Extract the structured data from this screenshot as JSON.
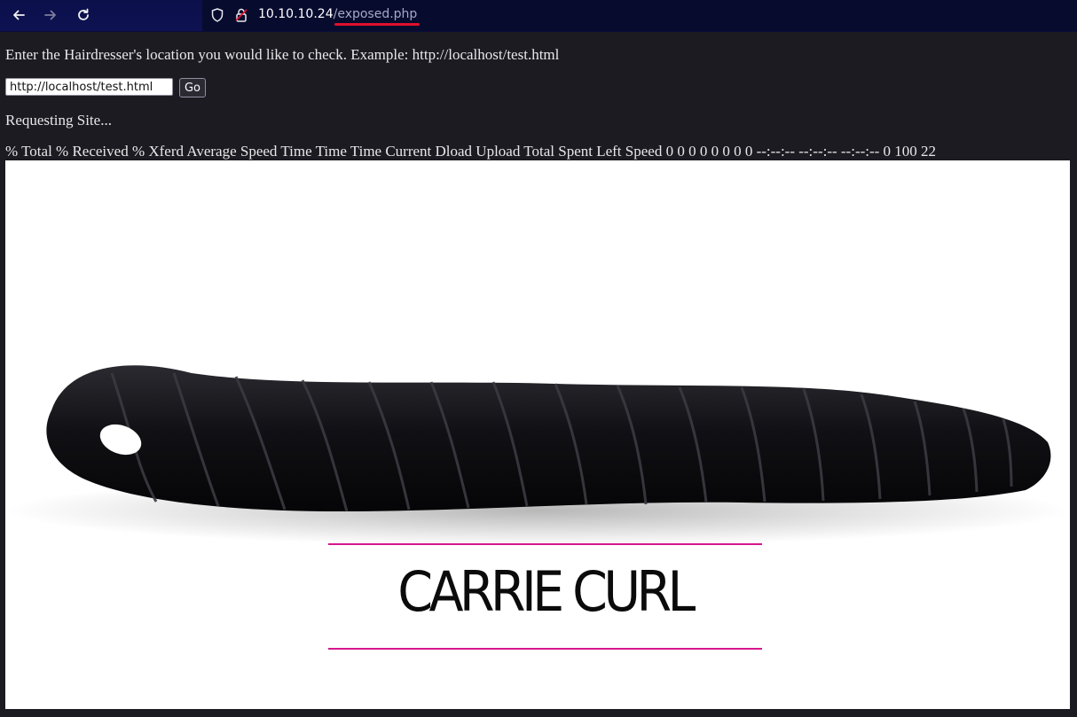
{
  "browser": {
    "url_host": "10.10.10.24",
    "url_path": "/exposed.php",
    "icons": {
      "back": "back-arrow-icon",
      "forward": "forward-arrow-icon",
      "reload": "reload-icon",
      "shield": "shield-icon",
      "lock": "insecure-lock-icon"
    },
    "accent_underline": "#e0102a"
  },
  "page": {
    "prompt": "Enter the Hairdresser's location you would like to check. Example: http://localhost/test.html",
    "input_value": "http://localhost/test.html",
    "go_label": "Go",
    "status": "Requesting Site...",
    "curl_output": "% Total % Received % Xferd Average Speed Time Time Time Current Dload Upload Total Spent Left Speed 0 0 0 0 0 0 0 0 --:--:-- --:--:-- --:--:-- 0 100 22"
  },
  "product_image": {
    "brand": "CARRIE CURL",
    "accent_color": "#d6178d"
  }
}
